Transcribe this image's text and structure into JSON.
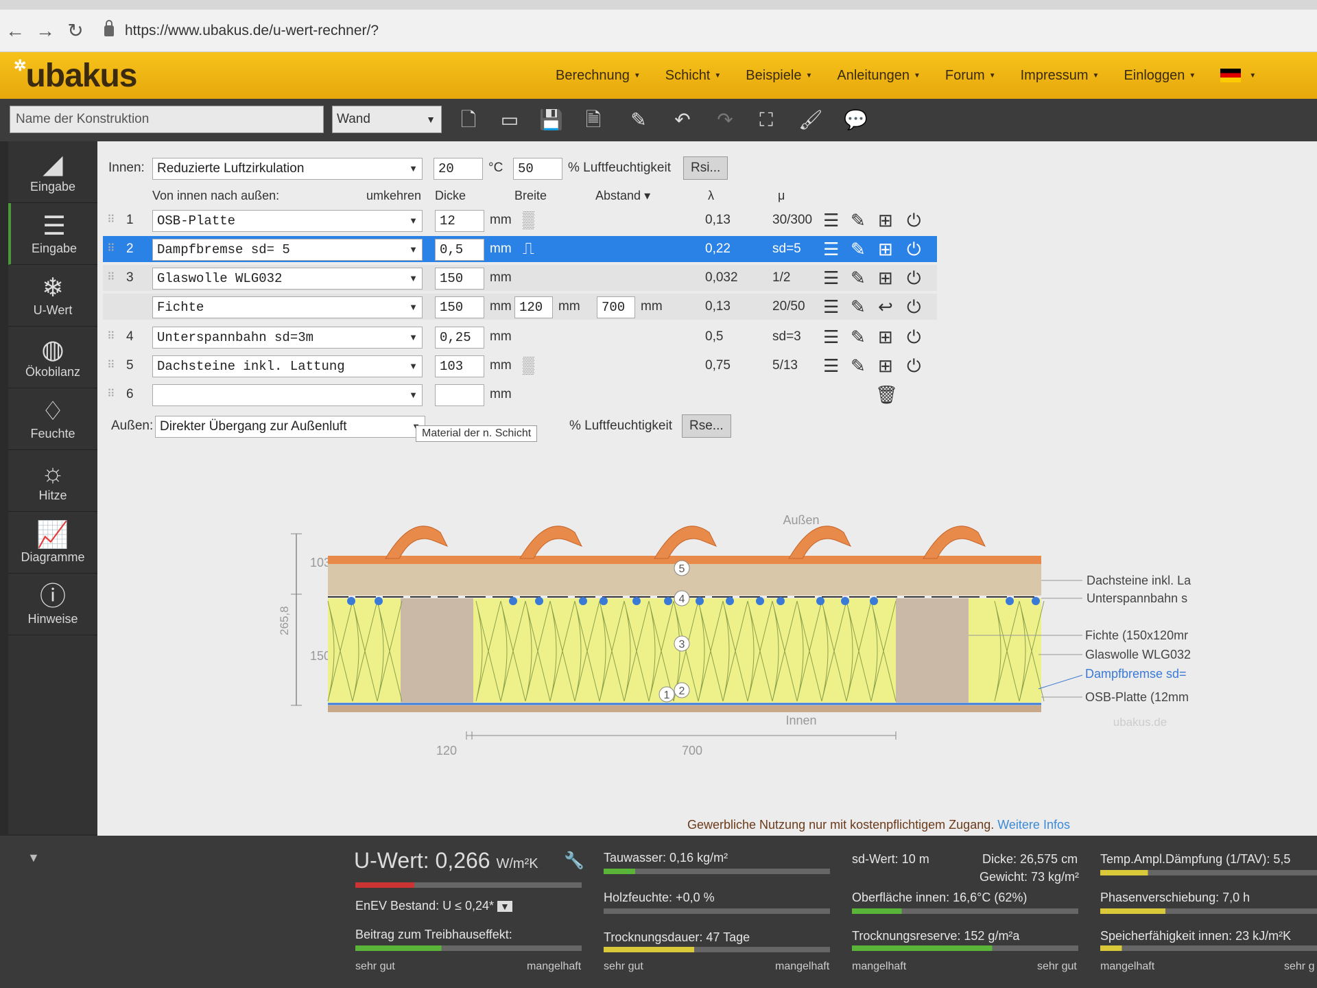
{
  "browser": {
    "url": "https://www.ubakus.de/u-wert-rechner/?"
  },
  "header": {
    "logo": "ubakus",
    "menu": [
      "Berechnung",
      "Schicht",
      "Beispiele",
      "Anleitungen",
      "Forum",
      "Impressum",
      "Einloggen"
    ]
  },
  "toolbar": {
    "name_placeholder": "Name der Konstruktion",
    "type": "Wand"
  },
  "sidebar": [
    {
      "label": "Eingabe",
      "icon": "ruler-icon"
    },
    {
      "label": "Eingabe",
      "icon": "layers-icon"
    },
    {
      "label": "U-Wert",
      "icon": "thermometer-icon"
    },
    {
      "label": "Ökobilanz",
      "icon": "globe-icon"
    },
    {
      "label": "Feuchte",
      "icon": "drop-icon"
    },
    {
      "label": "Hitze",
      "icon": "sun-icon"
    },
    {
      "label": "Diagramme",
      "icon": "chart-icon"
    },
    {
      "label": "Hinweise",
      "icon": "warning-icon"
    }
  ],
  "inside": {
    "label": "Innen:",
    "condition": "Reduzierte Luftzirkulation",
    "temp": "20",
    "temp_unit": "°C",
    "humidity": "50",
    "humidity_label": "% Luftfeuchtigkeit",
    "rsi": "Rsi..."
  },
  "columns": {
    "direction": "Von innen nach außen:",
    "reverse": "umkehren",
    "thickness": "Dicke",
    "width": "Breite",
    "spacing": "Abstand",
    "lambda": "λ",
    "mu": "μ"
  },
  "layers": [
    {
      "num": "1",
      "material": "OSB-Platte",
      "thickness": "12",
      "unit": "mm",
      "lambda": "0,13",
      "mu": "30/300"
    },
    {
      "num": "2",
      "material": "Dampfbremse sd= 5",
      "thickness": "0,5",
      "unit": "mm",
      "lambda": "0,22",
      "mu": "sd=5"
    },
    {
      "num": "3",
      "material": "Glaswolle WLG032",
      "thickness": "150",
      "unit": "mm",
      "lambda": "0,032",
      "mu": "1/2"
    },
    {
      "num": "",
      "material": "Fichte",
      "thickness": "150",
      "unit": "mm",
      "width": "120",
      "width_unit": "mm",
      "spacing": "700",
      "spacing_unit": "mm",
      "lambda": "0,13",
      "mu": "20/50"
    },
    {
      "num": "4",
      "material": "Unterspannbahn sd=3m",
      "thickness": "0,25",
      "unit": "mm",
      "lambda": "0,5",
      "mu": "sd=3"
    },
    {
      "num": "5",
      "material": "Dachsteine inkl. Lattung",
      "thickness": "103",
      "unit": "mm",
      "lambda": "0,75",
      "mu": "5/13"
    },
    {
      "num": "6",
      "material": "",
      "thickness": "",
      "unit": "mm",
      "lambda": "",
      "mu": ""
    }
  ],
  "outside": {
    "label": "Außen:",
    "condition": "Direkter Übergang zur Außenluft",
    "humidity_label": "% Luftfeuchtigkeit",
    "rse": "Rse...",
    "tooltip": "Material der n. Schicht"
  },
  "diagram": {
    "outside_label": "Außen",
    "inside_label": "Innen",
    "watermark": "ubakus.de",
    "dim_top": "103",
    "dim_mid": "150",
    "dim_total": "265,8",
    "dim_width1": "120",
    "dim_width2": "700",
    "markers": [
      "5",
      "4",
      "3",
      "2",
      "1"
    ],
    "legend": [
      "Dachsteine inkl. La",
      "Unterspannbahn s",
      "Fichte (150x120mr",
      "Glaswolle WLG032",
      "Dampfbremse sd=",
      "OSB-Platte (12mm"
    ],
    "colors": {
      "tile": "#e88a4a",
      "insulation": "#eef08a",
      "wood": "#c9b9a6",
      "membrane": "#3a7ad6"
    }
  },
  "footer": {
    "note": "Gewerbliche Nutzung nur mit kostenpflichtigem Zugang.",
    "link": "Weitere Infos"
  },
  "results": {
    "u_label": "U-Wert:",
    "u_value": "0,266",
    "u_unit": "W/m²K",
    "enev": "EnEV Bestand: U ≤ 0,24*",
    "greenhouse": "Beitrag zum Treibhauseffekt:",
    "tauwasser": "Tauwasser: 0,16 kg/m²",
    "holzfeuchte": "Holzfeuchte: +0,0 %",
    "trocknungsdauer": "Trocknungsdauer: 47 Tage",
    "sd": "sd-Wert: 10 m",
    "dicke": "Dicke: 26,575 cm",
    "gewicht": "Gewicht: 73 kg/m²",
    "oberflaeche": "Oberfläche innen: 16,6°C (62%)",
    "trocknungsreserve": "Trocknungsreserve: 152 g/m²a",
    "amplitude": "Temp.Ampl.Dämpfung (1/TAV): 5,5",
    "phase": "Phasenverschiebung: 7,0 h",
    "speicher": "Speicherfähigkeit innen: 23 kJ/m²K",
    "scale_good": "sehr gut",
    "scale_bad": "mangelhaft",
    "scale_good_trunc": "sehr g"
  }
}
